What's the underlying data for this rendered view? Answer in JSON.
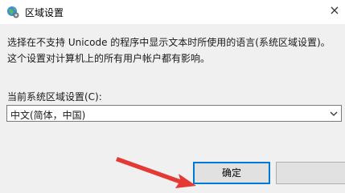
{
  "window": {
    "title": "区域设置",
    "icon": "globe-settings-icon",
    "close_glyph": "×"
  },
  "content": {
    "description": "选择在不支持 Unicode 的程序中显示文本时所使用的语言(系统区域设置)。这个设置对计算机上的所有用户帐户都有影响。",
    "current_locale_label": "当前系统区域设置(C):",
    "current_locale_value": "中文(简体，中国)"
  },
  "buttons": {
    "ok_label": "确定"
  },
  "annotation": {
    "arrow_color": "#e53935"
  }
}
